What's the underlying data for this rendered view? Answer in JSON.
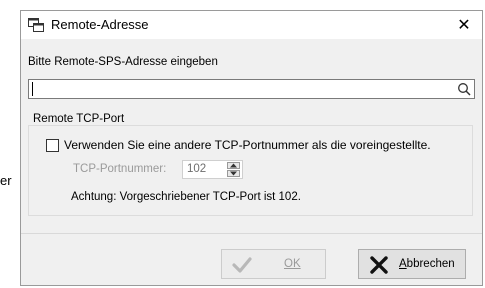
{
  "background": {
    "fragment": "er"
  },
  "dialog": {
    "title": "Remote-Adresse",
    "close_label": "✕",
    "prompt": "Bitte Remote-SPS-Adresse eingeben",
    "address_input": {
      "value": "",
      "placeholder": ""
    },
    "group": {
      "legend": "Remote TCP-Port",
      "checkbox_label": "Verwenden Sie eine andere TCP-Portnummer als die voreingestellte.",
      "checkbox_checked": false,
      "port_label": "TCP-Portnummer:",
      "port_value": "102",
      "note": "Achtung: Vorgeschriebener TCP-Port ist 102."
    },
    "buttons": {
      "ok": {
        "label": "OK",
        "enabled": false
      },
      "cancel": {
        "label_first": "A",
        "label_rest": "bbrechen"
      }
    }
  },
  "colors": {
    "dialog_bg": "#f0f0f0",
    "disabled_text": "#9a9a9a",
    "checkmark_disabled": "#b8b8b8"
  },
  "icons": {
    "title": "window-network-icon",
    "search": "search-icon",
    "ok": "checkmark-icon",
    "cancel": "x-icon"
  }
}
